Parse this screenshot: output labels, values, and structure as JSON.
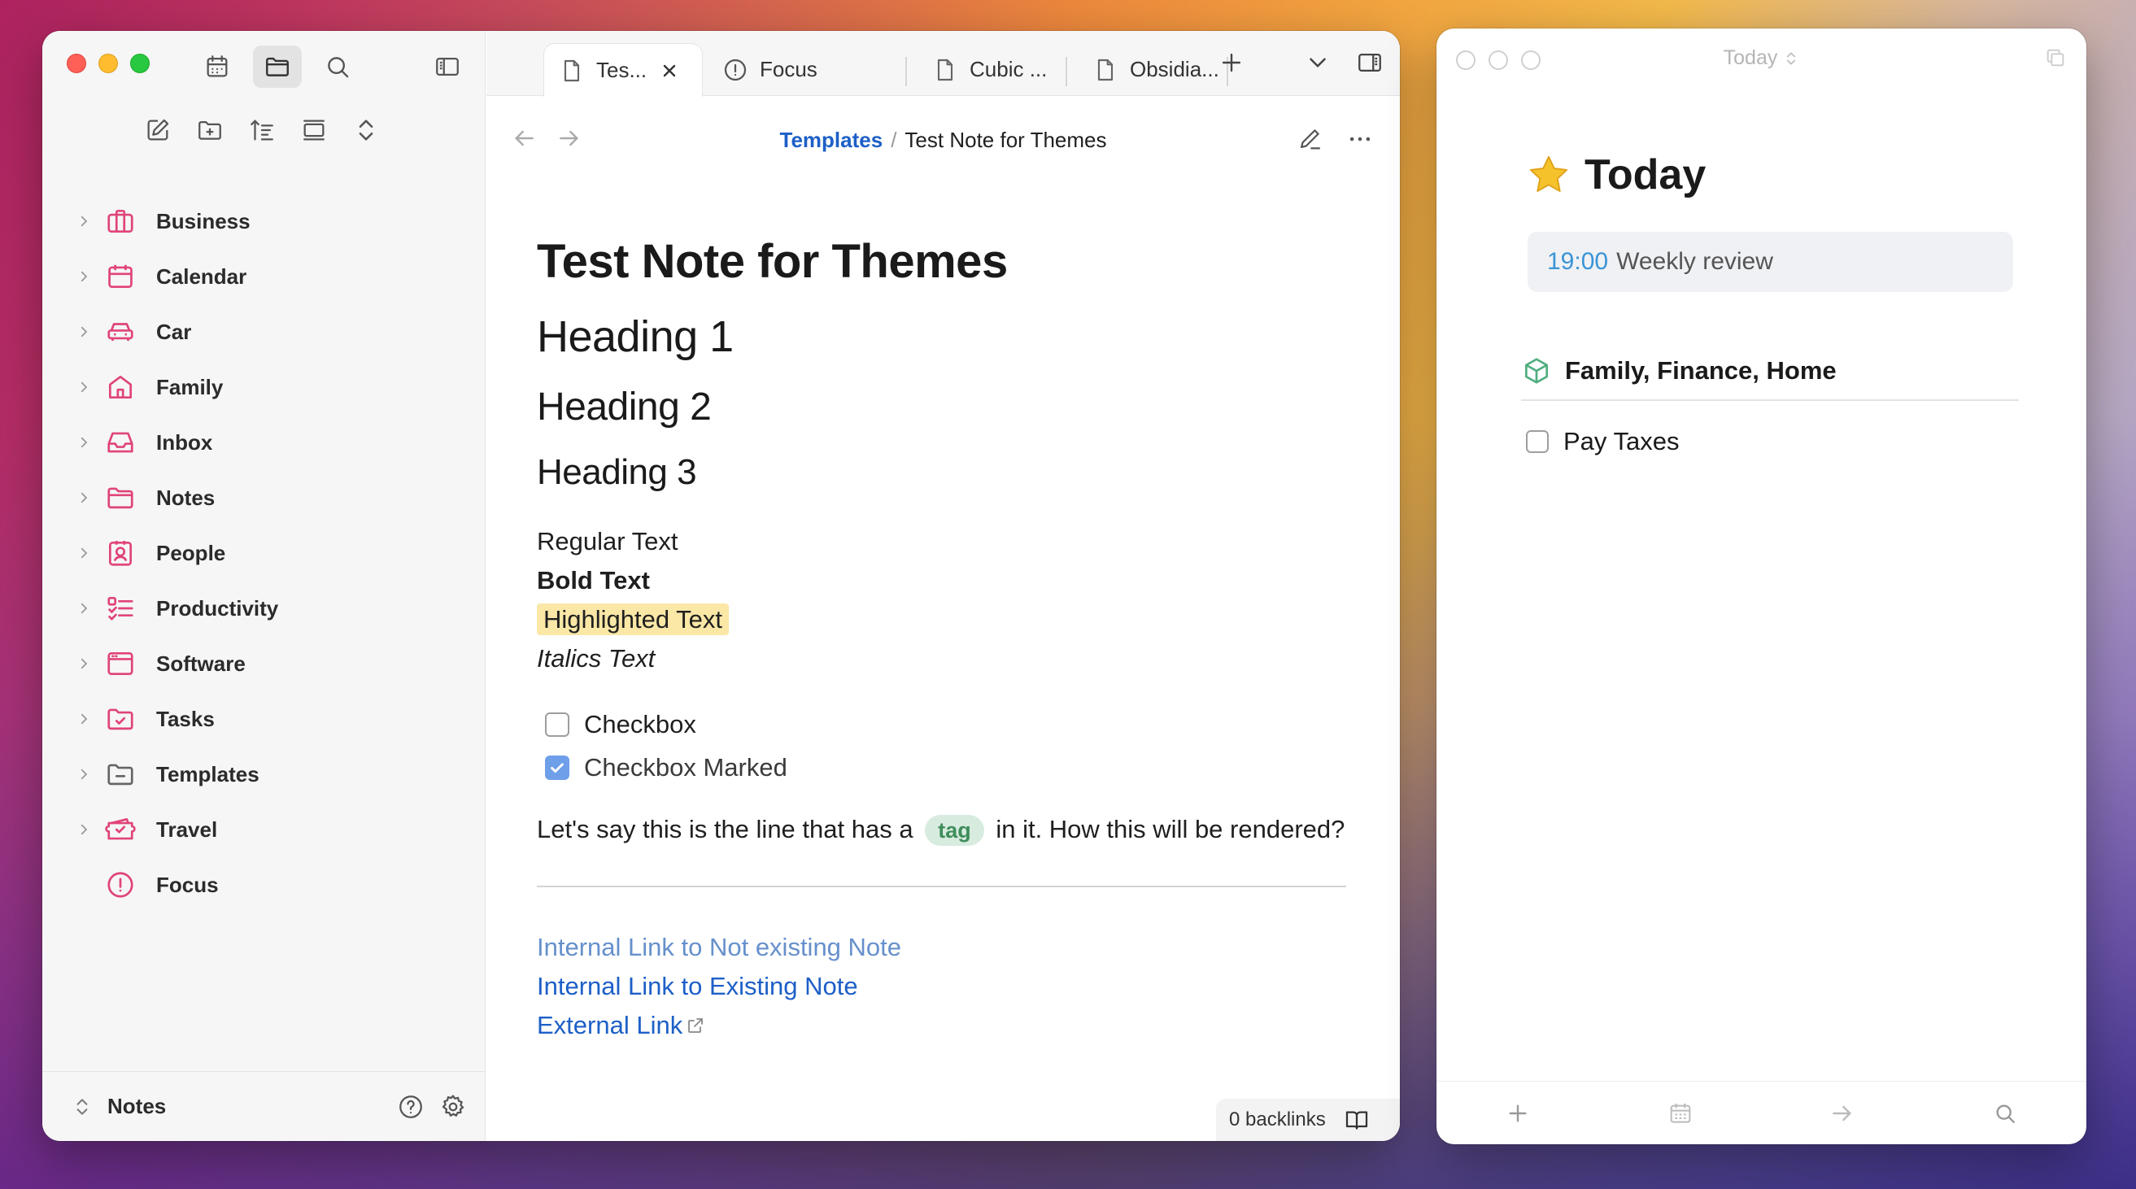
{
  "main": {
    "tabs": [
      {
        "label": "Tes...",
        "active": true
      },
      {
        "label": "Focus",
        "active": false
      },
      {
        "label": "Cubic ...",
        "active": false
      },
      {
        "label": "Obsidia...",
        "active": false
      }
    ],
    "breadcrumb": {
      "parent": "Templates",
      "separator": "/",
      "current": "Test Note for Themes"
    },
    "sidebar": {
      "items": [
        {
          "label": "Business",
          "icon": "briefcase-icon"
        },
        {
          "label": "Calendar",
          "icon": "calendar-icon"
        },
        {
          "label": "Car",
          "icon": "car-icon"
        },
        {
          "label": "Family",
          "icon": "home-icon"
        },
        {
          "label": "Inbox",
          "icon": "inbox-icon"
        },
        {
          "label": "Notes",
          "icon": "folder-icon"
        },
        {
          "label": "People",
          "icon": "contact-icon"
        },
        {
          "label": "Productivity",
          "icon": "list-checks-icon"
        },
        {
          "label": "Software",
          "icon": "app-window-icon"
        },
        {
          "label": "Tasks",
          "icon": "folder-check-icon"
        },
        {
          "label": "Templates",
          "icon": "folder-minus-icon"
        },
        {
          "label": "Travel",
          "icon": "ticket-icon"
        },
        {
          "label": "Focus",
          "icon": "alert-circle-icon"
        }
      ],
      "vault_name": "Notes"
    },
    "note": {
      "title": "Test Note for Themes",
      "h1": "Heading 1",
      "h2": "Heading 2",
      "h3": "Heading 3",
      "regular": "Regular Text",
      "bold": "Bold Text",
      "highlighted": "Highlighted Text",
      "italics": "Italics Text",
      "checkbox": "Checkbox",
      "checkbox_marked": "Checkbox Marked",
      "line_before_tag": "Let's say this is the line that has a",
      "tag": "tag",
      "line_after_tag": "in it. How this will be rendered?",
      "link_not_existing": "Internal Link to Not existing Note",
      "link_existing": "Internal Link to Existing Note",
      "link_external": "External Link"
    },
    "backlinks": "0 backlinks"
  },
  "today": {
    "window_title": "Today",
    "heading": "Today",
    "event_time": "19:00",
    "event_title": "Weekly review",
    "group": "Family, Finance, Home",
    "task": "Pay Taxes"
  },
  "colors": {
    "accent_pink": "#e0447a",
    "link_blue": "#1d5fc7",
    "highlight": "#fbe7a6",
    "tag_bg": "#d8ebdf",
    "tag_fg": "#3f8d5c"
  }
}
